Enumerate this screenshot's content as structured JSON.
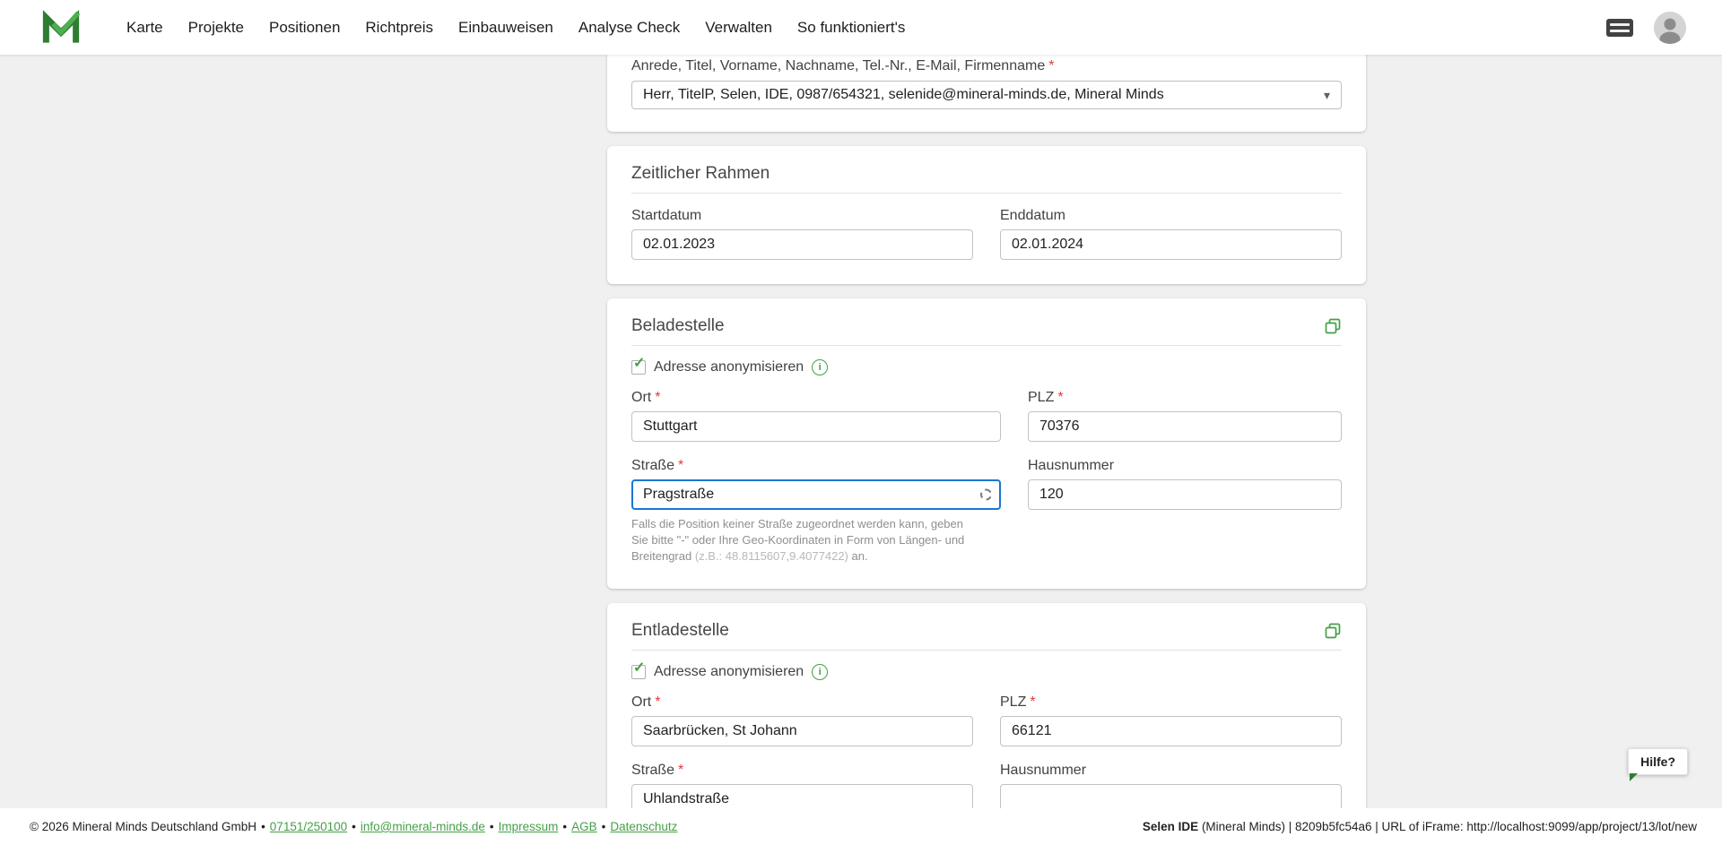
{
  "colors": {
    "accent": "#43a047",
    "accent_dark": "#2e7d32",
    "focus_border": "#1976d2",
    "required": "#e53935"
  },
  "glyphs": {
    "caret": "▾",
    "info": "i",
    "check": "✓"
  },
  "nav": {
    "items": [
      "Karte",
      "Projekte",
      "Positionen",
      "Richtpreis",
      "Einbauweisen",
      "Analyse Check",
      "Verwalten",
      "So funktioniert's"
    ]
  },
  "form": {
    "required_marker": "*",
    "anonymize_label": "Adresse anonymisieren",
    "field_labels": {
      "ort": "Ort",
      "plz": "PLZ",
      "strasse": "Straße",
      "hausnummer": "Hausnummer"
    },
    "contact": {
      "label": "Anrede, Titel, Vorname, Nachname, Tel.-Nr., E-Mail, Firmenname",
      "value": "Herr, TitelP, Selen, IDE, 0987/654321, selenide@mineral-minds.de, Mineral Minds"
    },
    "timeframe": {
      "title": "Zeitlicher Rahmen",
      "start_label": "Startdatum",
      "start_value": "02.01.2023",
      "end_label": "Enddatum",
      "end_value": "02.01.2024"
    },
    "beladestelle": {
      "title": "Beladestelle",
      "ort": "Stuttgart",
      "plz": "70376",
      "strasse": "Pragstraße",
      "hausnummer": "120",
      "helper_line1": "Falls die Position keiner Straße zugeordnet werden kann, geben",
      "helper_line2": "Sie bitte \"-\" oder Ihre Geo-Koordinaten in Form von Längen- und",
      "helper_line3_prefix": "Breitengrad ",
      "helper_line3_coords": "(z.B.: 48.8115607,9.4077422)",
      "helper_line3_suffix": " an."
    },
    "entladestelle": {
      "title": "Entladestelle",
      "ort": "Saarbrücken, St Johann",
      "plz": "66121",
      "strasse": "Uhlandstraße",
      "hausnummer": ""
    }
  },
  "help_button": {
    "label": "Hilfe?"
  },
  "footer": {
    "copyright": "© 2026 Mineral Minds Deutschland GmbH",
    "separator": "•",
    "phone": "07151/250100",
    "email": "info@mineral-minds.de",
    "links": [
      "Impressum",
      "AGB",
      "Datenschutz"
    ],
    "right_bold": "Selen IDE",
    "right_rest": " (Mineral Minds) | 8209b5fc54a6 | URL of iFrame: http://localhost:9099/app/project/13/lot/new"
  }
}
